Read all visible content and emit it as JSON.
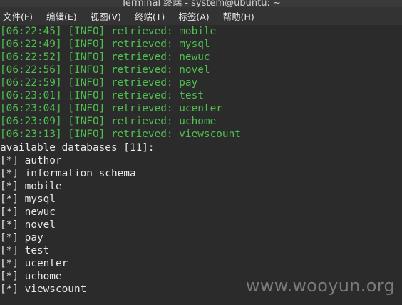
{
  "window": {
    "title": "Terminal 终端 - system@ubuntu: ~"
  },
  "menu": [
    {
      "label": "文件(F)"
    },
    {
      "label": "编辑(E)"
    },
    {
      "label": "视图(V)"
    },
    {
      "label": "终端(T)"
    },
    {
      "label": "标签(A)"
    },
    {
      "label": "帮助(H)"
    }
  ],
  "terminal": {
    "log_lines": [
      "[06:22:45] [INFO] retrieved: mobile",
      "[06:22:49] [INFO] retrieved: mysql",
      "[06:22:52] [INFO] retrieved: newuc",
      "[06:22:56] [INFO] retrieved: novel",
      "[06:22:59] [INFO] retrieved: pay",
      "[06:23:01] [INFO] retrieved: test",
      "[06:23:04] [INFO] retrieved: ucenter",
      "[06:23:09] [INFO] retrieved: uchome",
      "[06:23:13] [INFO] retrieved: viewscount"
    ],
    "summary": "available databases [11]:",
    "databases": [
      "[*] author",
      "[*] information_schema",
      "[*] mobile",
      "[*] mysql",
      "[*] newuc",
      "[*] novel",
      "[*] pay",
      "[*] test",
      "[*] ucenter",
      "[*] uchome",
      "[*] viewscount"
    ],
    "log_color": "#4fc04f",
    "text_color": "#e8e8e8"
  },
  "watermark": "www.wooyun.org"
}
